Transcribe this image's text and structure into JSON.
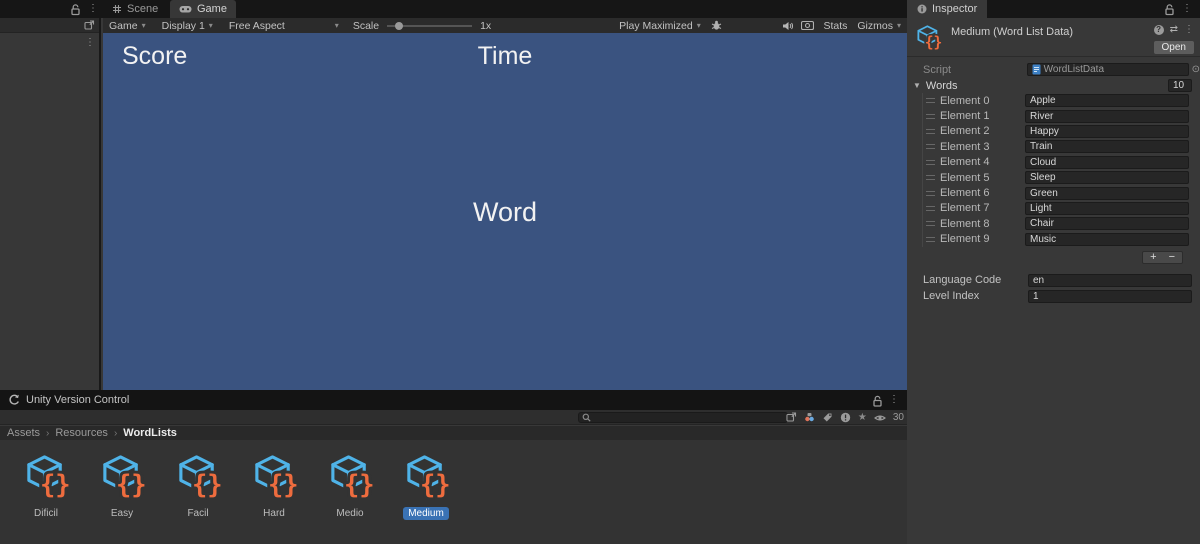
{
  "icons": {
    "kebab": "⋮",
    "dropdown_arrow": "▾",
    "foldout_open": "▼",
    "star": "★",
    "picker": "⊙",
    "presets": "⇄",
    "help": "?"
  },
  "window": {
    "scene_tab": "Scene",
    "game_tab": "Game"
  },
  "game_toolbar": {
    "game_menu": "Game",
    "display": "Display 1",
    "aspect": "Free Aspect",
    "scale_label": "Scale",
    "scale_value": "1x",
    "play_maximized": "Play Maximized",
    "stats": "Stats",
    "gizmos": "Gizmos"
  },
  "game_view": {
    "score": "Score",
    "time": "Time",
    "word": "Word"
  },
  "version_control": {
    "title": "Unity Version Control"
  },
  "project": {
    "search_placeholder": "",
    "visible_count": "30",
    "breadcrumb": [
      "Assets",
      "Resources",
      "WordLists"
    ],
    "breadcrumb_separator": "›",
    "assets": [
      {
        "name": "Dificil",
        "selected": false
      },
      {
        "name": "Easy",
        "selected": false
      },
      {
        "name": "Facil",
        "selected": false
      },
      {
        "name": "Hard",
        "selected": false
      },
      {
        "name": "Medio",
        "selected": false
      },
      {
        "name": "Medium",
        "selected": true
      }
    ]
  },
  "inspector": {
    "tab": "Inspector",
    "title": "Medium (Word List Data)",
    "open_button": "Open",
    "script_label": "Script",
    "script_value": "WordListData",
    "words_label": "Words",
    "words_count": "10",
    "elements": [
      {
        "label": "Element 0",
        "value": "Apple"
      },
      {
        "label": "Element 1",
        "value": "River"
      },
      {
        "label": "Element 2",
        "value": "Happy"
      },
      {
        "label": "Element 3",
        "value": "Train"
      },
      {
        "label": "Element 4",
        "value": "Cloud"
      },
      {
        "label": "Element 5",
        "value": "Sleep"
      },
      {
        "label": "Element 6",
        "value": "Green"
      },
      {
        "label": "Element 7",
        "value": "Light"
      },
      {
        "label": "Element 8",
        "value": "Chair"
      },
      {
        "label": "Element 9",
        "value": "Music"
      }
    ],
    "add_button": "+",
    "remove_button": "−",
    "language_code_label": "Language Code",
    "language_code_value": "en",
    "level_index_label": "Level Index",
    "level_index_value": "1"
  },
  "colors": {
    "game_background": "#3a5380",
    "selection_blue": "#3a72b4",
    "so_icon_blue": "#4fb3e8",
    "so_icon_orange": "#ee6c3e"
  }
}
